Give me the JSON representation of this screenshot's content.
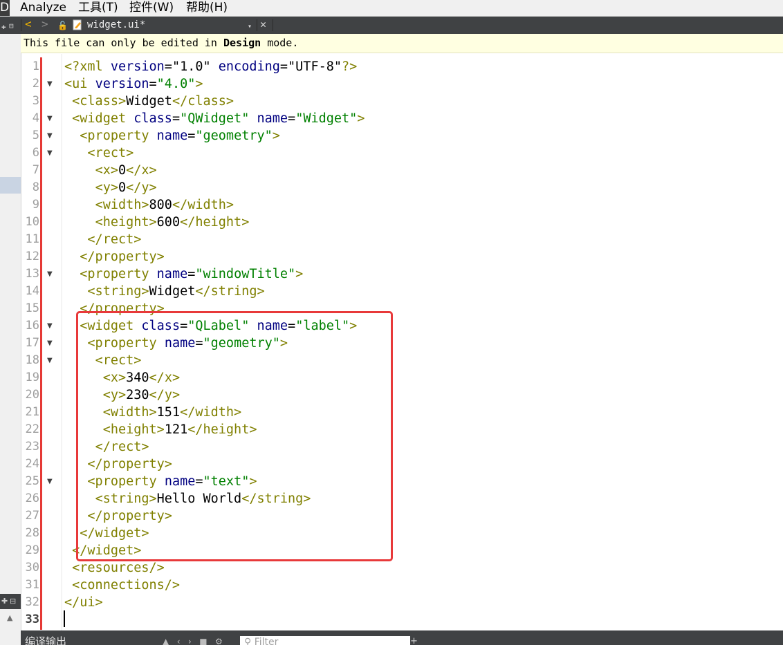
{
  "menubar": {
    "cut_item": "D)",
    "items": [
      "Analyze",
      "工具(T)",
      "控件(W)",
      "帮助(H)"
    ]
  },
  "toolbar": {
    "file_name": "widget.ui*",
    "back_icon": "<",
    "forward_icon": ">",
    "dropdown_icon": "▾",
    "close_icon": "✕"
  },
  "infobar": {
    "prefix": "This file can only be edited in ",
    "emphasis": "Design",
    "suffix": " mode."
  },
  "editor": {
    "current_line": 33,
    "lines": [
      {
        "n": "1",
        "fold": false,
        "segments": [
          [
            "tag",
            "<?xml "
          ],
          [
            "attr",
            "version"
          ],
          [
            "txt",
            "="
          ],
          [
            "txt",
            "\"1.0\""
          ],
          [
            "txt",
            " "
          ],
          [
            "attr",
            "encoding"
          ],
          [
            "txt",
            "="
          ],
          [
            "txt",
            "\"UTF-8\""
          ],
          [
            "tag",
            "?>"
          ]
        ]
      },
      {
        "n": "2",
        "fold": true,
        "segments": [
          [
            "tag",
            "<ui "
          ],
          [
            "attr",
            "version"
          ],
          [
            "txt",
            "="
          ],
          [
            "str",
            "\"4.0\""
          ],
          [
            "tag",
            ">"
          ]
        ]
      },
      {
        "n": "3",
        "fold": false,
        "segments": [
          [
            "txt",
            " "
          ],
          [
            "tag",
            "<class>"
          ],
          [
            "txt",
            "Widget"
          ],
          [
            "tag",
            "</class>"
          ]
        ]
      },
      {
        "n": "4",
        "fold": true,
        "segments": [
          [
            "txt",
            " "
          ],
          [
            "tag",
            "<widget "
          ],
          [
            "attr",
            "class"
          ],
          [
            "txt",
            "="
          ],
          [
            "str",
            "\"QWidget\""
          ],
          [
            "txt",
            " "
          ],
          [
            "attr",
            "name"
          ],
          [
            "txt",
            "="
          ],
          [
            "str",
            "\"Widget\""
          ],
          [
            "tag",
            ">"
          ]
        ]
      },
      {
        "n": "5",
        "fold": true,
        "segments": [
          [
            "txt",
            "  "
          ],
          [
            "tag",
            "<property "
          ],
          [
            "attr",
            "name"
          ],
          [
            "txt",
            "="
          ],
          [
            "str",
            "\"geometry\""
          ],
          [
            "tag",
            ">"
          ]
        ]
      },
      {
        "n": "6",
        "fold": true,
        "segments": [
          [
            "txt",
            "   "
          ],
          [
            "tag",
            "<rect>"
          ]
        ]
      },
      {
        "n": "7",
        "fold": false,
        "segments": [
          [
            "txt",
            "    "
          ],
          [
            "tag",
            "<x>"
          ],
          [
            "txt",
            "0"
          ],
          [
            "tag",
            "</x>"
          ]
        ]
      },
      {
        "n": "8",
        "fold": false,
        "segments": [
          [
            "txt",
            "    "
          ],
          [
            "tag",
            "<y>"
          ],
          [
            "txt",
            "0"
          ],
          [
            "tag",
            "</y>"
          ]
        ]
      },
      {
        "n": "9",
        "fold": false,
        "segments": [
          [
            "txt",
            "    "
          ],
          [
            "tag",
            "<width>"
          ],
          [
            "txt",
            "800"
          ],
          [
            "tag",
            "</width>"
          ]
        ]
      },
      {
        "n": "10",
        "fold": false,
        "segments": [
          [
            "txt",
            "    "
          ],
          [
            "tag",
            "<height>"
          ],
          [
            "txt",
            "600"
          ],
          [
            "tag",
            "</height>"
          ]
        ]
      },
      {
        "n": "11",
        "fold": false,
        "segments": [
          [
            "txt",
            "   "
          ],
          [
            "tag",
            "</rect>"
          ]
        ]
      },
      {
        "n": "12",
        "fold": false,
        "segments": [
          [
            "txt",
            "  "
          ],
          [
            "tag",
            "</property>"
          ]
        ]
      },
      {
        "n": "13",
        "fold": true,
        "segments": [
          [
            "txt",
            "  "
          ],
          [
            "tag",
            "<property "
          ],
          [
            "attr",
            "name"
          ],
          [
            "txt",
            "="
          ],
          [
            "str",
            "\"windowTitle\""
          ],
          [
            "tag",
            ">"
          ]
        ]
      },
      {
        "n": "14",
        "fold": false,
        "segments": [
          [
            "txt",
            "   "
          ],
          [
            "tag",
            "<string>"
          ],
          [
            "txt",
            "Widget"
          ],
          [
            "tag",
            "</string>"
          ]
        ]
      },
      {
        "n": "15",
        "fold": false,
        "segments": [
          [
            "txt",
            "  "
          ],
          [
            "tag",
            "</property>"
          ]
        ]
      },
      {
        "n": "16",
        "fold": true,
        "segments": [
          [
            "txt",
            "  "
          ],
          [
            "tag",
            "<widget "
          ],
          [
            "attr",
            "class"
          ],
          [
            "txt",
            "="
          ],
          [
            "str",
            "\"QLabel\""
          ],
          [
            "txt",
            " "
          ],
          [
            "attr",
            "name"
          ],
          [
            "txt",
            "="
          ],
          [
            "str",
            "\"label\""
          ],
          [
            "tag",
            ">"
          ]
        ]
      },
      {
        "n": "17",
        "fold": true,
        "segments": [
          [
            "txt",
            "   "
          ],
          [
            "tag",
            "<property "
          ],
          [
            "attr",
            "name"
          ],
          [
            "txt",
            "="
          ],
          [
            "str",
            "\"geometry\""
          ],
          [
            "tag",
            ">"
          ]
        ]
      },
      {
        "n": "18",
        "fold": true,
        "segments": [
          [
            "txt",
            "    "
          ],
          [
            "tag",
            "<rect>"
          ]
        ]
      },
      {
        "n": "19",
        "fold": false,
        "segments": [
          [
            "txt",
            "     "
          ],
          [
            "tag",
            "<x>"
          ],
          [
            "txt",
            "340"
          ],
          [
            "tag",
            "</x>"
          ]
        ]
      },
      {
        "n": "20",
        "fold": false,
        "segments": [
          [
            "txt",
            "     "
          ],
          [
            "tag",
            "<y>"
          ],
          [
            "txt",
            "230"
          ],
          [
            "tag",
            "</y>"
          ]
        ]
      },
      {
        "n": "21",
        "fold": false,
        "segments": [
          [
            "txt",
            "     "
          ],
          [
            "tag",
            "<width>"
          ],
          [
            "txt",
            "151"
          ],
          [
            "tag",
            "</width>"
          ]
        ]
      },
      {
        "n": "22",
        "fold": false,
        "segments": [
          [
            "txt",
            "     "
          ],
          [
            "tag",
            "<height>"
          ],
          [
            "txt",
            "121"
          ],
          [
            "tag",
            "</height>"
          ]
        ]
      },
      {
        "n": "23",
        "fold": false,
        "segments": [
          [
            "txt",
            "    "
          ],
          [
            "tag",
            "</rect>"
          ]
        ]
      },
      {
        "n": "24",
        "fold": false,
        "segments": [
          [
            "txt",
            "   "
          ],
          [
            "tag",
            "</property>"
          ]
        ]
      },
      {
        "n": "25",
        "fold": true,
        "segments": [
          [
            "txt",
            "   "
          ],
          [
            "tag",
            "<property "
          ],
          [
            "attr",
            "name"
          ],
          [
            "txt",
            "="
          ],
          [
            "str",
            "\"text\""
          ],
          [
            "tag",
            ">"
          ]
        ]
      },
      {
        "n": "26",
        "fold": false,
        "segments": [
          [
            "txt",
            "    "
          ],
          [
            "tag",
            "<string>"
          ],
          [
            "txt",
            "Hello World"
          ],
          [
            "tag",
            "</string>"
          ]
        ]
      },
      {
        "n": "27",
        "fold": false,
        "segments": [
          [
            "txt",
            "   "
          ],
          [
            "tag",
            "</property>"
          ]
        ]
      },
      {
        "n": "28",
        "fold": false,
        "segments": [
          [
            "txt",
            "  "
          ],
          [
            "tag",
            "</widget>"
          ]
        ]
      },
      {
        "n": "29",
        "fold": false,
        "segments": [
          [
            "txt",
            " "
          ],
          [
            "tag",
            "</widget>"
          ]
        ]
      },
      {
        "n": "30",
        "fold": false,
        "segments": [
          [
            "txt",
            " "
          ],
          [
            "tag",
            "<resources/>"
          ]
        ]
      },
      {
        "n": "31",
        "fold": false,
        "segments": [
          [
            "txt",
            " "
          ],
          [
            "tag",
            "<connections/>"
          ]
        ]
      },
      {
        "n": "32",
        "fold": false,
        "segments": [
          [
            "tag",
            "</ui>"
          ]
        ]
      },
      {
        "n": "33",
        "fold": false,
        "segments": []
      }
    ]
  },
  "output_pane": {
    "title": "编译输出",
    "filter_placeholder": "Filter",
    "plus_icon": "+"
  },
  "colors": {
    "highlight_box": "#e8393a",
    "gutter_line": "#e53935",
    "xml_tag": "#808000",
    "xml_string": "#008000",
    "xml_attr": "#000080"
  }
}
